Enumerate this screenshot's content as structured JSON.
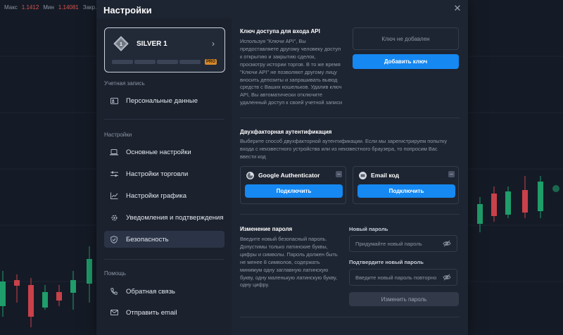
{
  "ticker": {
    "label1": "Макс",
    "value1": "1.1412",
    "label2": "Мин",
    "value2": "1.14081",
    "label3": "Закр."
  },
  "modal": {
    "title": "Настройки"
  },
  "profile": {
    "level": "SILVER 1",
    "badge_number": "1",
    "pro": "PRO"
  },
  "sidebar": {
    "account_title": "Учетная запись",
    "account_items": [
      {
        "label": "Персональные данные",
        "icon": "id-card-icon"
      }
    ],
    "settings_title": "Настройки",
    "settings_items": [
      {
        "label": "Основные настройки",
        "icon": "laptop-icon"
      },
      {
        "label": "Настройки торговли",
        "icon": "sliders-icon"
      },
      {
        "label": "Настройки графика",
        "icon": "chart-line-icon"
      },
      {
        "label": "Уведомления и подтверждения",
        "icon": "gear-icon"
      },
      {
        "label": "Безопасность",
        "icon": "shield-icon",
        "active": true
      }
    ],
    "help_title": "Помощь",
    "help_items": [
      {
        "label": "Обратная связь",
        "icon": "phone-icon"
      },
      {
        "label": "Отправить email",
        "icon": "mail-icon"
      }
    ]
  },
  "api": {
    "title": "Ключ доступа для входа API",
    "description_lines": [
      "Используя \"Ключи API\", Вы",
      "предоставляете другому человеку доступ",
      "к открытию и закрытию сделок,",
      "просмотру истории торгов. В то же время",
      "\"Ключи API\" не позволяют другому лицу",
      "вносить депозиты и запрашивать вывод",
      "средств с Ваших кошельков. Удалив ключ",
      "API, Вы автоматически отключите",
      "удаленный доступ к своей учетной записи"
    ],
    "status": "Ключ не добавлен",
    "add_button": "Добавить ключ"
  },
  "twofa": {
    "title": "Двухфакторная аутентификация",
    "description_lines": [
      "Выберите способ двухфакторной аутентификации. Если мы зарегистрируем попытку",
      "входа с неизвестного устройства или из неизвестного браузера, то попросим Вас",
      "ввести код"
    ],
    "methods": [
      {
        "name": "Google Authenticator",
        "button": "Подключить"
      },
      {
        "name": "Email код",
        "button": "Подключить"
      }
    ]
  },
  "password": {
    "title": "Изменение пароля",
    "description_lines": [
      "Введите новый безопасный пароль.",
      "Допустимы только латинские буквы,",
      "цифры и символы. Пароль должен быть",
      "не менее 8 символов, содержать",
      "минимум одну заглавную латинскую",
      "букву, одну маленькую латинскую букву,",
      "одну цифру."
    ],
    "new_label": "Новый пароль",
    "new_placeholder": "Придумайте новый пароль",
    "confirm_label": "Подтвердите новый пароль",
    "confirm_placeholder": "Введите новый пароль повторно",
    "submit": "Изменить пароль"
  },
  "colors": {
    "accent": "#1588f2",
    "candle_up": "#1f9d6a",
    "candle_down": "#c9414a"
  }
}
